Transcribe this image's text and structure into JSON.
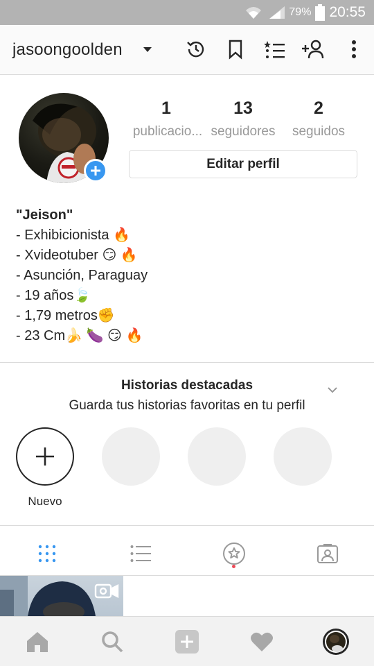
{
  "status_bar": {
    "battery_percent": "79%",
    "time": "20:55",
    "icons": [
      "wifi-icon",
      "signal-icon",
      "battery-icon"
    ]
  },
  "app_bar": {
    "username": "jasoongoolden",
    "icons": [
      "archive-history-icon",
      "bookmark-icon",
      "close-friends-list-icon",
      "add-person-icon",
      "overflow-menu-icon"
    ]
  },
  "profile": {
    "stats": [
      {
        "number": "1",
        "label": "publicacio..."
      },
      {
        "number": "13",
        "label": "seguidores"
      },
      {
        "number": "2",
        "label": "seguidos"
      }
    ],
    "edit_button_label": "Editar perfil"
  },
  "bio": {
    "name": "\"Jeison\"",
    "lines": [
      "- Exhibicionista 🔥",
      "- Xvideotuber 😏 🔥",
      "- Asunción, Paraguay",
      "- 19 años🍃",
      "- 1,79 metros✊",
      "- 23 Cm🍌 🍆 😏 🔥"
    ]
  },
  "highlights": {
    "title": "Historias destacadas",
    "subtitle": "Guarda tus historias favoritas en tu perfil",
    "new_label": "Nuevo"
  },
  "tabs": [
    "grid-icon",
    "list-icon",
    "tagged-star-icon",
    "tagged-person-icon"
  ],
  "bottom_nav": [
    "home-icon",
    "search-icon",
    "add-post-icon",
    "activity-heart-icon",
    "profile-avatar-icon"
  ],
  "colors": {
    "accent_blue": "#3897f0",
    "notification_red": "#ed4956",
    "status_bar": "#b3b3b3",
    "divider": "#dbdbdb"
  }
}
